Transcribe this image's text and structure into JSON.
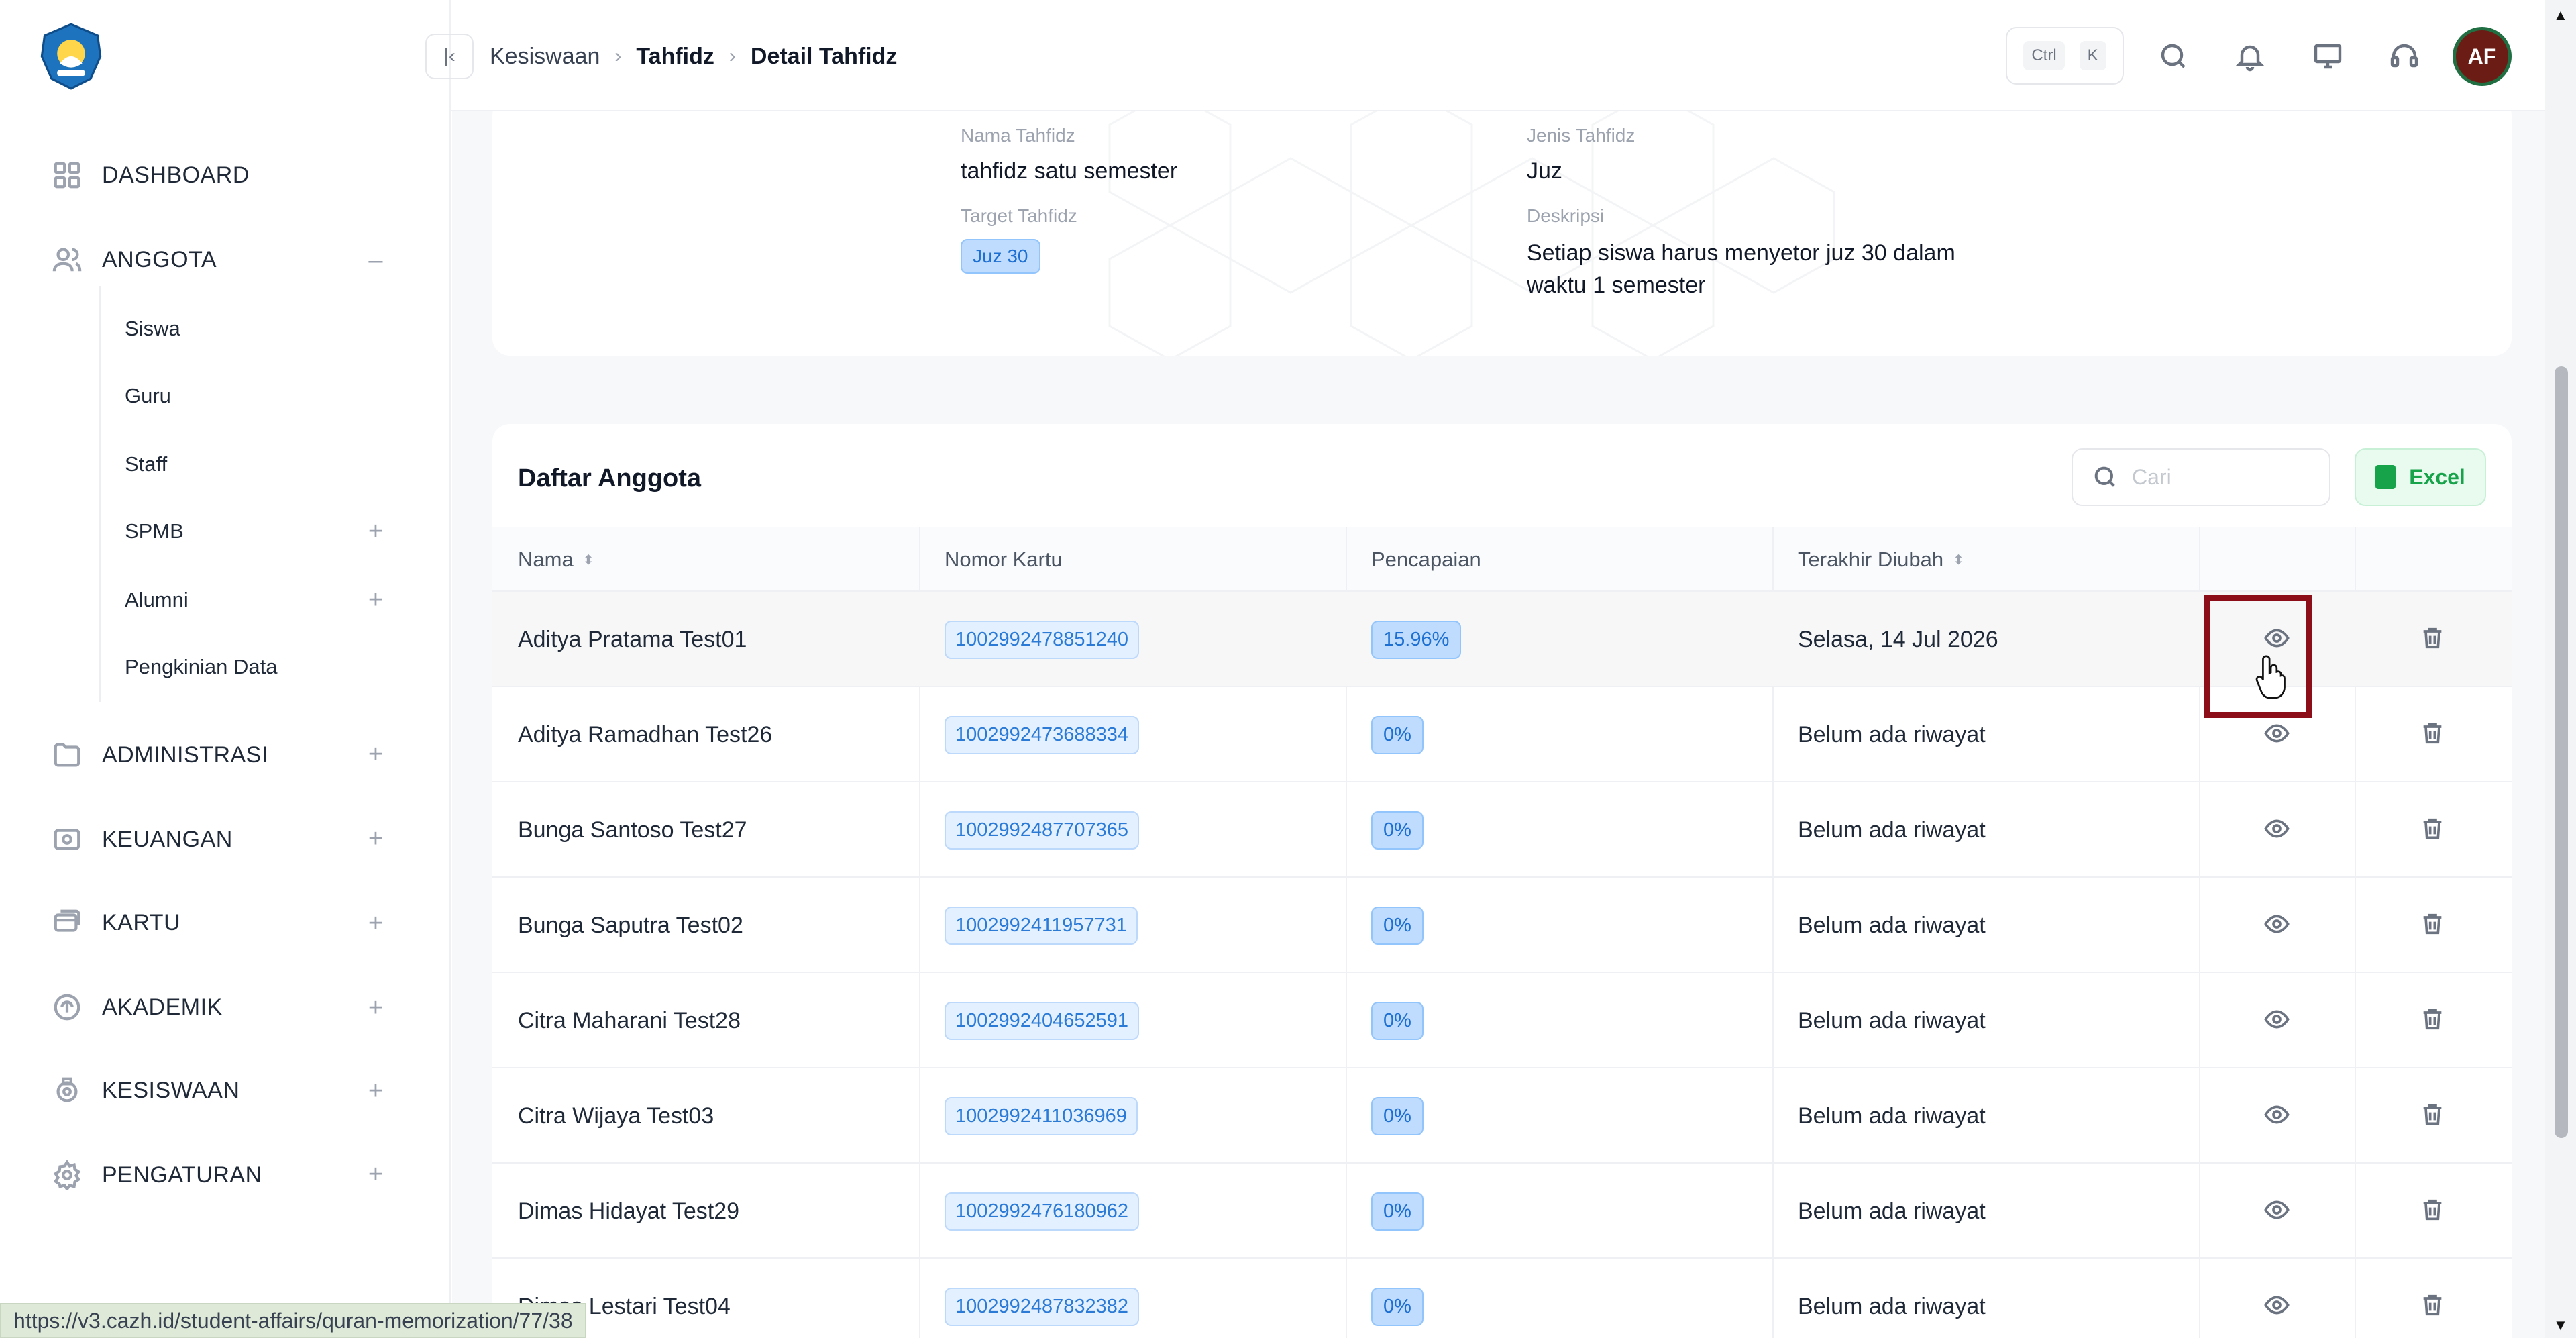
{
  "sidebar": {
    "menu": [
      {
        "label": "DASHBOARD",
        "icon": "dashboard-grid-icon",
        "toggle": ""
      },
      {
        "label": "ANGGOTA",
        "icon": "users-icon",
        "toggle": "–"
      },
      {
        "label": "ADMINISTRASI",
        "icon": "folder-icon",
        "toggle": "+"
      },
      {
        "label": "KEUANGAN",
        "icon": "money-icon",
        "toggle": "+"
      },
      {
        "label": "KARTU",
        "icon": "card-icon",
        "toggle": "+"
      },
      {
        "label": "AKADEMIK",
        "icon": "academic-icon",
        "toggle": "+"
      },
      {
        "label": "KESISWAAN",
        "icon": "student-affairs-icon",
        "toggle": "+"
      },
      {
        "label": "PENGATURAN",
        "icon": "gear-icon",
        "toggle": "+"
      }
    ],
    "anggota_sub": [
      {
        "label": "Siswa",
        "toggle": ""
      },
      {
        "label": "Guru",
        "toggle": ""
      },
      {
        "label": "Staff",
        "toggle": ""
      },
      {
        "label": "SPMB",
        "toggle": "+"
      },
      {
        "label": "Alumni",
        "toggle": "+"
      },
      {
        "label": "Pengkinian Data",
        "toggle": ""
      }
    ]
  },
  "header": {
    "breadcrumb": [
      "Kesiswaan",
      "Tahfidz",
      "Detail Tahfidz"
    ],
    "shortcut": [
      "Ctrl",
      "K"
    ],
    "avatar_initials": "AF"
  },
  "detail": {
    "nama_label": "Nama Tahfidz",
    "nama_value": "tahfidz satu semester",
    "jenis_label": "Jenis Tahfidz",
    "jenis_value": "Juz",
    "target_label": "Target Tahfidz",
    "target_value": "Juz 30",
    "deskripsi_label": "Deskripsi",
    "deskripsi_line1": "Setiap siswa harus menyetor juz 30 dalam",
    "deskripsi_line2": "waktu 1 semester"
  },
  "members": {
    "title": "Daftar Anggota",
    "search_placeholder": "Cari",
    "excel_label": "Excel",
    "columns": [
      "Nama",
      "Nomor Kartu",
      "Pencapaian",
      "Terakhir Diubah"
    ],
    "rows": [
      {
        "name": "Aditya Pratama Test01",
        "card": "1002992478851240",
        "progress": "15.96%",
        "updated": "Selasa, 14 Jul 2026"
      },
      {
        "name": "Aditya Ramadhan Test26",
        "card": "1002992473688334",
        "progress": "0%",
        "updated": "Belum ada riwayat"
      },
      {
        "name": "Bunga Santoso Test27",
        "card": "1002992487707365",
        "progress": "0%",
        "updated": "Belum ada riwayat"
      },
      {
        "name": "Bunga Saputra Test02",
        "card": "1002992411957731",
        "progress": "0%",
        "updated": "Belum ada riwayat"
      },
      {
        "name": "Citra Maharani Test28",
        "card": "1002992404652591",
        "progress": "0%",
        "updated": "Belum ada riwayat"
      },
      {
        "name": "Citra Wijaya Test03",
        "card": "1002992411036969",
        "progress": "0%",
        "updated": "Belum ada riwayat"
      },
      {
        "name": "Dimas Hidayat Test29",
        "card": "1002992476180962",
        "progress": "0%",
        "updated": "Belum ada riwayat"
      },
      {
        "name": "Dimas Lestari Test04",
        "card": "1002992487832382",
        "progress": "0%",
        "updated": "Belum ada riwayat"
      }
    ]
  },
  "status_url": "https://v3.cazh.id/student-affairs/quran-memorization/77/38",
  "colors": {
    "accent": "#2b7bd6",
    "excel": "#16a34a",
    "highlight": "#8b0e18"
  }
}
